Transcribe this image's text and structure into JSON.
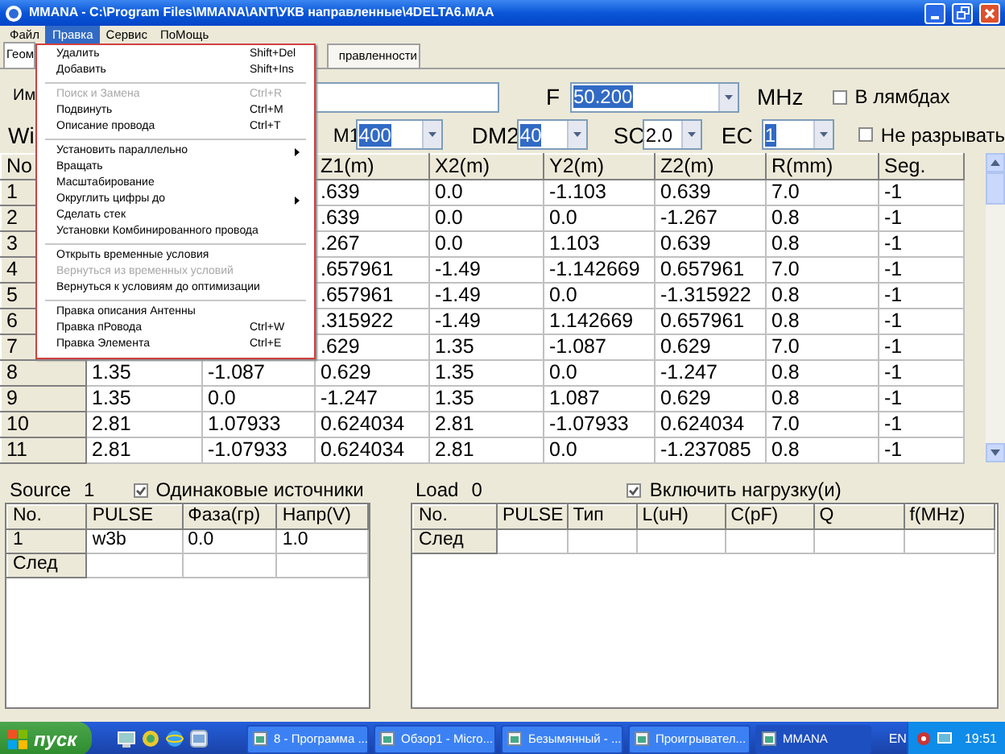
{
  "window": {
    "title": "MMANA - C:\\Program Files\\MMANA\\ANT\\УКВ направленные\\4DELTA6.MAA"
  },
  "menu_bar": [
    {
      "label": "Файл",
      "selected": false
    },
    {
      "label": "Правка",
      "selected": true
    },
    {
      "label": "Сервис",
      "selected": false
    },
    {
      "label": "ПоМощь",
      "selected": false
    }
  ],
  "tabs": [
    {
      "label": "Геом",
      "selected": true
    },
    {
      "label": "правленности",
      "selected": false
    }
  ],
  "edit_menu": [
    [
      {
        "label": "Удалить",
        "shortcut": "Shift+Del",
        "disabled": false,
        "submenu": false
      },
      {
        "label": "Добавить",
        "shortcut": "Shift+Ins",
        "disabled": false,
        "submenu": false
      }
    ],
    [
      {
        "label": "Поиск и Замена",
        "shortcut": "Ctrl+R",
        "disabled": true,
        "submenu": false
      },
      {
        "label": "Подвинуть",
        "shortcut": "Ctrl+M",
        "disabled": false,
        "submenu": false
      },
      {
        "label": "Описание провода",
        "shortcut": "Ctrl+T",
        "disabled": false,
        "submenu": false
      }
    ],
    [
      {
        "label": "Установить параллельно",
        "disabled": false,
        "submenu": true
      },
      {
        "label": "Вращать",
        "disabled": false,
        "submenu": false
      },
      {
        "label": "Масштабирование",
        "disabled": false,
        "submenu": false
      },
      {
        "label": "Округлить цифры до",
        "disabled": false,
        "submenu": true
      },
      {
        "label": "Сделать стек",
        "disabled": false,
        "submenu": false
      },
      {
        "label": "Установки Комбинированного провода",
        "disabled": false,
        "submenu": false
      }
    ],
    [
      {
        "label": "Открыть временные условия",
        "disabled": false,
        "submenu": false
      },
      {
        "label": "Вернуться из временных условий",
        "disabled": true,
        "submenu": false
      },
      {
        "label": "Вернуться к условиям до оптимизации",
        "disabled": false,
        "submenu": false
      }
    ],
    [
      {
        "label": "Правка описания Антенны",
        "disabled": false,
        "submenu": false
      },
      {
        "label": "Правка пРовода",
        "shortcut": "Ctrl+W",
        "disabled": false,
        "submenu": false
      },
      {
        "label": "Правка Элемента",
        "shortcut": "Ctrl+E",
        "disabled": false,
        "submenu": false
      }
    ]
  ],
  "form": {
    "name_label": "Им",
    "freq": {
      "label": "F",
      "value": "50.200",
      "highlighted": true,
      "unit": "MHz"
    },
    "in_lambda": {
      "label": "В лямбдах",
      "checked": false
    },
    "wire_label": "Wi",
    "combos": [
      {
        "label": "M1",
        "value": "400",
        "highlighted": true
      },
      {
        "label": "DM2",
        "value": "40",
        "highlighted": true
      },
      {
        "label": "SC",
        "value": "2.0",
        "highlighted": false
      },
      {
        "label": "EC",
        "value": "1",
        "highlighted": true
      }
    ],
    "no_break": {
      "label": "Не разрывать",
      "checked": false
    }
  },
  "wires": {
    "columns": {
      "no": "No",
      "cells": [
        "Z1(m)",
        "X2(m)",
        "Y2(m)",
        "Z2(m)",
        "R(mm)",
        "Seg."
      ]
    },
    "rows": [
      {
        "no": "1",
        "cells": [
          ".639",
          "0.0",
          "-1.103",
          "0.639",
          "7.0",
          "-1"
        ]
      },
      {
        "no": "2",
        "cells": [
          ".639",
          "0.0",
          "0.0",
          "-1.267",
          "0.8",
          "-1"
        ]
      },
      {
        "no": "3",
        "cells": [
          ".267",
          "0.0",
          "1.103",
          "0.639",
          "0.8",
          "-1"
        ]
      },
      {
        "no": "4",
        "cells": [
          ".657961",
          "-1.49",
          "-1.142669",
          "0.657961",
          "7.0",
          "-1"
        ]
      },
      {
        "no": "5",
        "cells": [
          ".657961",
          "-1.49",
          "0.0",
          "-1.315922",
          "0.8",
          "-1"
        ]
      },
      {
        "no": "6",
        "cells": [
          ".315922",
          "-1.49",
          "1.142669",
          "0.657961",
          "0.8",
          "-1"
        ]
      },
      {
        "no": "7",
        "cells": [
          ".629",
          "1.35",
          "-1.087",
          "0.629",
          "7.0",
          "-1"
        ]
      },
      {
        "no": "8",
        "cells": [
          "1.35",
          "-1.087",
          "0.629",
          "1.35",
          "0.0",
          "-1.247",
          "0.8",
          "-1"
        ]
      },
      {
        "no": "9",
        "cells": [
          "1.35",
          "0.0",
          "-1.247",
          "1.35",
          "1.087",
          "0.629",
          "0.8",
          "-1"
        ]
      },
      {
        "no": "10",
        "cells": [
          "2.81",
          "1.07933",
          "0.624034",
          "2.81",
          "-1.07933",
          "0.624034",
          "7.0",
          "-1"
        ]
      },
      {
        "no": "11",
        "cells": [
          "2.81",
          "-1.07933",
          "0.624034",
          "2.81",
          "0.0",
          "-1.237085",
          "0.8",
          "-1"
        ]
      }
    ]
  },
  "sources": {
    "label": "Source",
    "count": "1",
    "same": {
      "label": "Одинаковые источники",
      "checked": true
    },
    "columns": [
      "No.",
      "PULSE",
      "Фаза(гр)",
      "Напр(V)"
    ],
    "rows": [
      {
        "cells": [
          "1",
          "w3b",
          "0.0",
          "1.0"
        ]
      }
    ],
    "next": "След"
  },
  "loads": {
    "label": "Load",
    "count": "0",
    "enable": {
      "label": "Включить нагрузку(и)",
      "checked": true
    },
    "columns": [
      "No.",
      "PULSE",
      "Тип",
      "L(uH)",
      "C(pF)",
      "Q",
      "f(MHz)"
    ],
    "next": "След"
  },
  "taskbar": {
    "start": "пуск",
    "tasks": [
      {
        "label": "8 - Программа ...",
        "selected": false
      },
      {
        "label": "Обзор1 - Micro...",
        "selected": false
      },
      {
        "label": "Безымянный - ...",
        "selected": false
      },
      {
        "label": "Проигрывател...",
        "selected": false
      },
      {
        "label": "MMANA",
        "selected": true
      }
    ],
    "language": "EN",
    "clock": "19:51"
  }
}
